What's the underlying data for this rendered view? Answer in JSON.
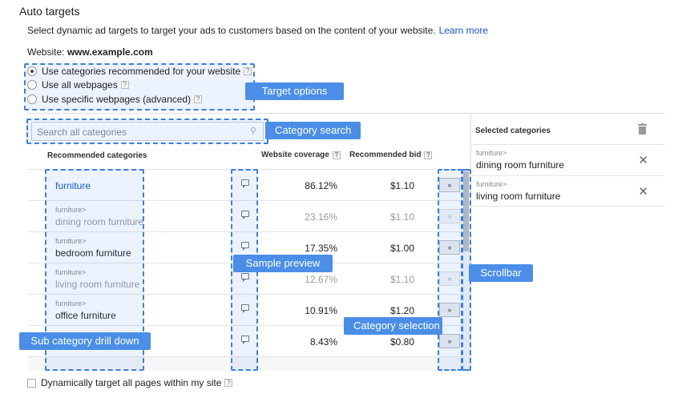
{
  "title": "Auto targets",
  "description": "Select dynamic ad targets to target your ads to customers based on the content of your website.",
  "learn_more": "Learn more",
  "website": {
    "label": "Website:",
    "value": "www.example.com"
  },
  "target_options": [
    {
      "label": "Use categories recommended for your website",
      "selected": true
    },
    {
      "label": "Use all webpages",
      "selected": false
    },
    {
      "label": "Use specific webpages (advanced)",
      "selected": false
    }
  ],
  "help_glyph": "?",
  "search": {
    "placeholder": "Search all categories"
  },
  "table": {
    "headers": {
      "category": "Recommended categories",
      "coverage": "Website coverage",
      "bid": "Recommended bid",
      "selected": "Selected categories"
    },
    "select_glyph": "»",
    "rows": [
      {
        "parent": "",
        "name": "furniture",
        "coverage": "86.12%",
        "bid": "$1.10",
        "faded": false
      },
      {
        "parent": "furniture>",
        "name": "dining room furniture",
        "coverage": "23.16%",
        "bid": "$1.10",
        "faded": true
      },
      {
        "parent": "furniture>",
        "name": "bedroom furniture",
        "coverage": "17.35%",
        "bid": "$1.00",
        "faded": false
      },
      {
        "parent": "furniture>",
        "name": "living room furniture",
        "coverage": "12.67%",
        "bid": "$1.10",
        "faded": true
      },
      {
        "parent": "furniture>",
        "name": "office furniture",
        "coverage": "10.91%",
        "bid": "$1.20",
        "faded": false
      },
      {
        "parent": "",
        "name": "",
        "coverage": "8.43%",
        "bid": "$0.80",
        "faded": false
      }
    ]
  },
  "selected_categories": [
    {
      "parent": "furniture>",
      "name": "dining room furniture",
      "remove": "✕"
    },
    {
      "parent": "furniture>",
      "name": "living room furniture",
      "remove": "✕"
    }
  ],
  "callouts": {
    "target_options": "Target options",
    "category_search": "Category search",
    "sample_preview": "Sample preview",
    "scrollbar": "Scrollbar",
    "category_selection": "Category selection",
    "sub_category": "Sub category drill down"
  },
  "bottom_checkbox": "Dynamically target all pages within my site",
  "colors": {
    "accent": "#4a8ee8",
    "link": "#1155cc"
  }
}
